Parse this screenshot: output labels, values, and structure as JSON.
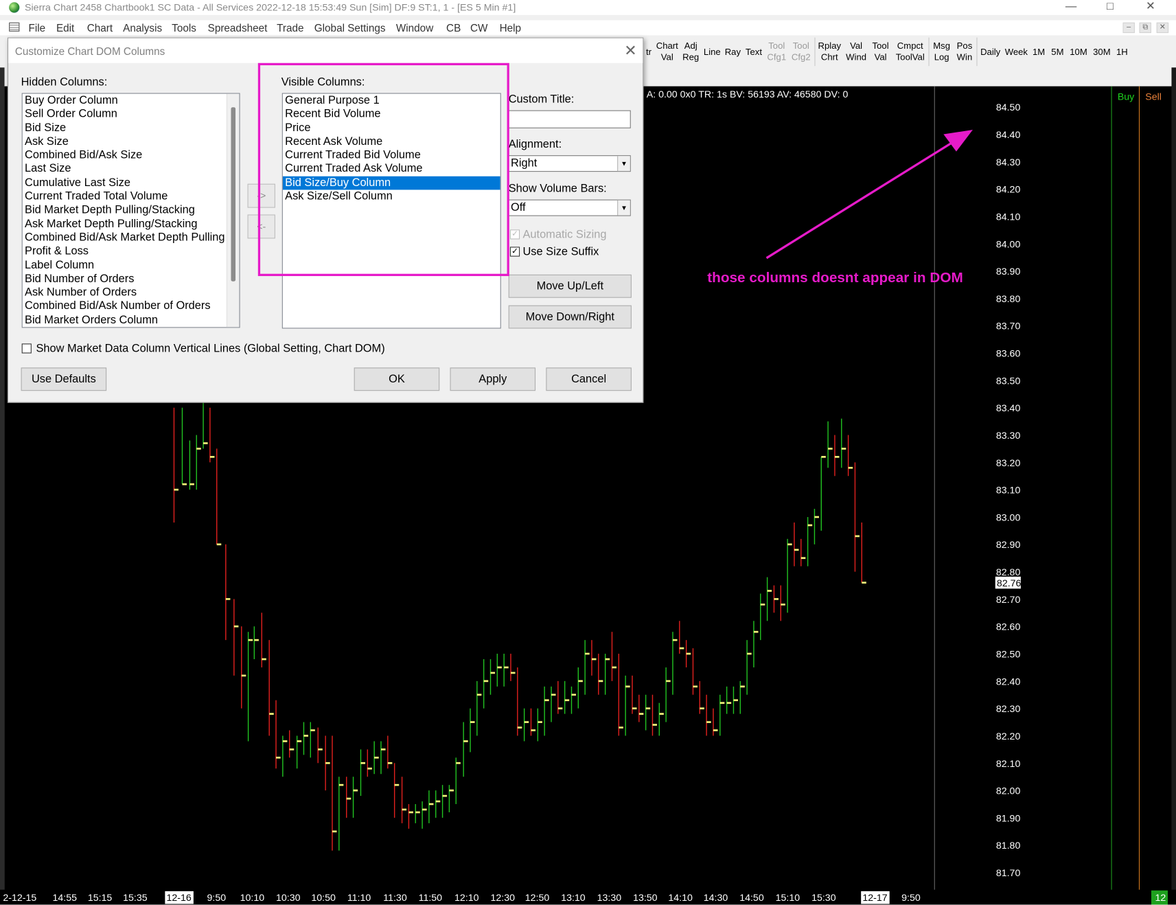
{
  "window": {
    "title": "Sierra Chart 2458 Chartbook1  SC Data - All Services 2022-12-18  15:53:49 Sun [Sim]  DF:9  ST:1, 1 - [ES  5 Min  #1]",
    "minimize": "—",
    "maximize": "□",
    "close": "✕"
  },
  "menu": [
    "File",
    "Edit",
    "Chart",
    "Analysis",
    "Tools",
    "Spreadsheet",
    "Trade",
    "Global Settings",
    "Window",
    "CB",
    "CW",
    "Help"
  ],
  "mdi": {
    "min": "–",
    "restore": "⧉",
    "close": "✕"
  },
  "toolbar": [
    {
      "l1": "tr",
      "l2": "",
      "dis": false
    },
    {
      "l1": "Chart",
      "l2": "Val",
      "dis": false
    },
    {
      "l1": "Adj",
      "l2": "Reg",
      "dis": false
    },
    {
      "l1": "Line",
      "l2": "",
      "dis": false
    },
    {
      "l1": "Ray",
      "l2": "",
      "dis": false
    },
    {
      "l1": "Text",
      "l2": "",
      "dis": false
    },
    {
      "l1": "Tool",
      "l2": "Cfg1",
      "dis": true
    },
    {
      "l1": "Tool",
      "l2": "Cfg2",
      "dis": true
    },
    {
      "l1": "Rplay",
      "l2": "Chrt",
      "dis": false
    },
    {
      "l1": "Val",
      "l2": "Wind",
      "dis": false
    },
    {
      "l1": "Tool",
      "l2": "Val",
      "dis": false
    },
    {
      "l1": "Cmpct",
      "l2": "ToolVal",
      "dis": false
    },
    {
      "l1": "Msg",
      "l2": "Log",
      "dis": false
    },
    {
      "l1": "Pos",
      "l2": "Win",
      "dis": false
    },
    {
      "l1": "Daily",
      "l2": "",
      "dis": false
    },
    {
      "l1": "Week",
      "l2": "",
      "dis": false
    },
    {
      "l1": "1M",
      "l2": "",
      "dis": false
    },
    {
      "l1": "5M",
      "l2": "",
      "dis": false
    },
    {
      "l1": "10M",
      "l2": "",
      "dis": false
    },
    {
      "l1": "30M",
      "l2": "",
      "dis": false
    },
    {
      "l1": "1H",
      "l2": "",
      "dis": false
    }
  ],
  "chart": {
    "info_line": "A: 0.00 0x0 TR: 1s BV: 56193 AV: 46580 DV: 0",
    "dom_headers": {
      "buy": "Buy",
      "sell": "Sell"
    },
    "price_labels": [
      "84.50",
      "84.40",
      "84.30",
      "84.20",
      "84.10",
      "84.00",
      "83.90",
      "83.80",
      "83.70",
      "83.60",
      "83.50",
      "83.40",
      "83.30",
      "83.20",
      "83.10",
      "83.00",
      "82.90",
      "82.80",
      "82.70",
      "82.60",
      "82.50",
      "82.40",
      "82.30",
      "82.20",
      "82.10",
      "82.00",
      "81.90",
      "81.80",
      "81.70"
    ],
    "last_price": "82.76",
    "time_labels": [
      "2-12-15",
      "14:55",
      "15:15",
      "15:35",
      "12-16",
      "9:50",
      "10:10",
      "10:30",
      "10:50",
      "11:10",
      "11:30",
      "11:50",
      "12:10",
      "12:30",
      "12:50",
      "13:10",
      "13:30",
      "13:50",
      "14:10",
      "14:30",
      "14:50",
      "15:10",
      "15:30",
      "12-17",
      "9:50"
    ],
    "corner_badge": "12",
    "colors": {
      "up": "#21c221",
      "down": "#e0201e",
      "close_tick": "#f2f27a",
      "background": "#000000",
      "axis_text": "#ffffff"
    }
  },
  "dialog": {
    "title": "Customize Chart DOM Columns",
    "close": "✕",
    "hidden_label": "Hidden Columns:",
    "hidden_columns": [
      "Buy Order Column",
      "Sell Order Column",
      "Bid Size",
      "Ask Size",
      "Combined Bid/Ask Size",
      "Last Size",
      "Cumulative Last Size",
      "Current Traded Total Volume",
      "Bid Market Depth Pulling/Stacking",
      "Ask Market Depth Pulling/Stacking",
      "Combined Bid/Ask Market Depth Pulling",
      "Profit & Loss",
      "Label Column",
      "Bid Number of Orders",
      "Ask Number of Orders",
      "Combined Bid/Ask Number of Orders",
      "Bid Market Orders Column"
    ],
    "add_button": "->",
    "remove_button": "<-",
    "visible_label": "Visible Columns:",
    "visible_columns": [
      "General Purpose 1",
      "Recent Bid Volume",
      "Price",
      "Recent Ask Volume",
      "Current Traded Bid Volume",
      "Current Traded Ask Volume",
      "Bid Size/Buy Column",
      "Ask Size/Sell Column"
    ],
    "selected_visible": "Bid Size/Buy Column",
    "custom_title_label": "Custom Title:",
    "custom_title_value": "",
    "alignment_label": "Alignment:",
    "alignment_value": "Right",
    "volume_bars_label": "Show Volume Bars:",
    "volume_bars_value": "Off",
    "automatic_sizing_label": "Automatic Sizing",
    "use_size_suffix_label": "Use Size Suffix",
    "move_up_label": "Move Up/Left",
    "move_down_label": "Move Down/Right",
    "vertical_lines_label": "Show Market Data Column Vertical Lines (Global Setting, Chart DOM)",
    "use_defaults_label": "Use Defaults",
    "ok_label": "OK",
    "apply_label": "Apply",
    "cancel_label": "Cancel"
  },
  "annotation": {
    "text": "those columns doesnt appear in DOM",
    "color": "#e61bc9"
  }
}
